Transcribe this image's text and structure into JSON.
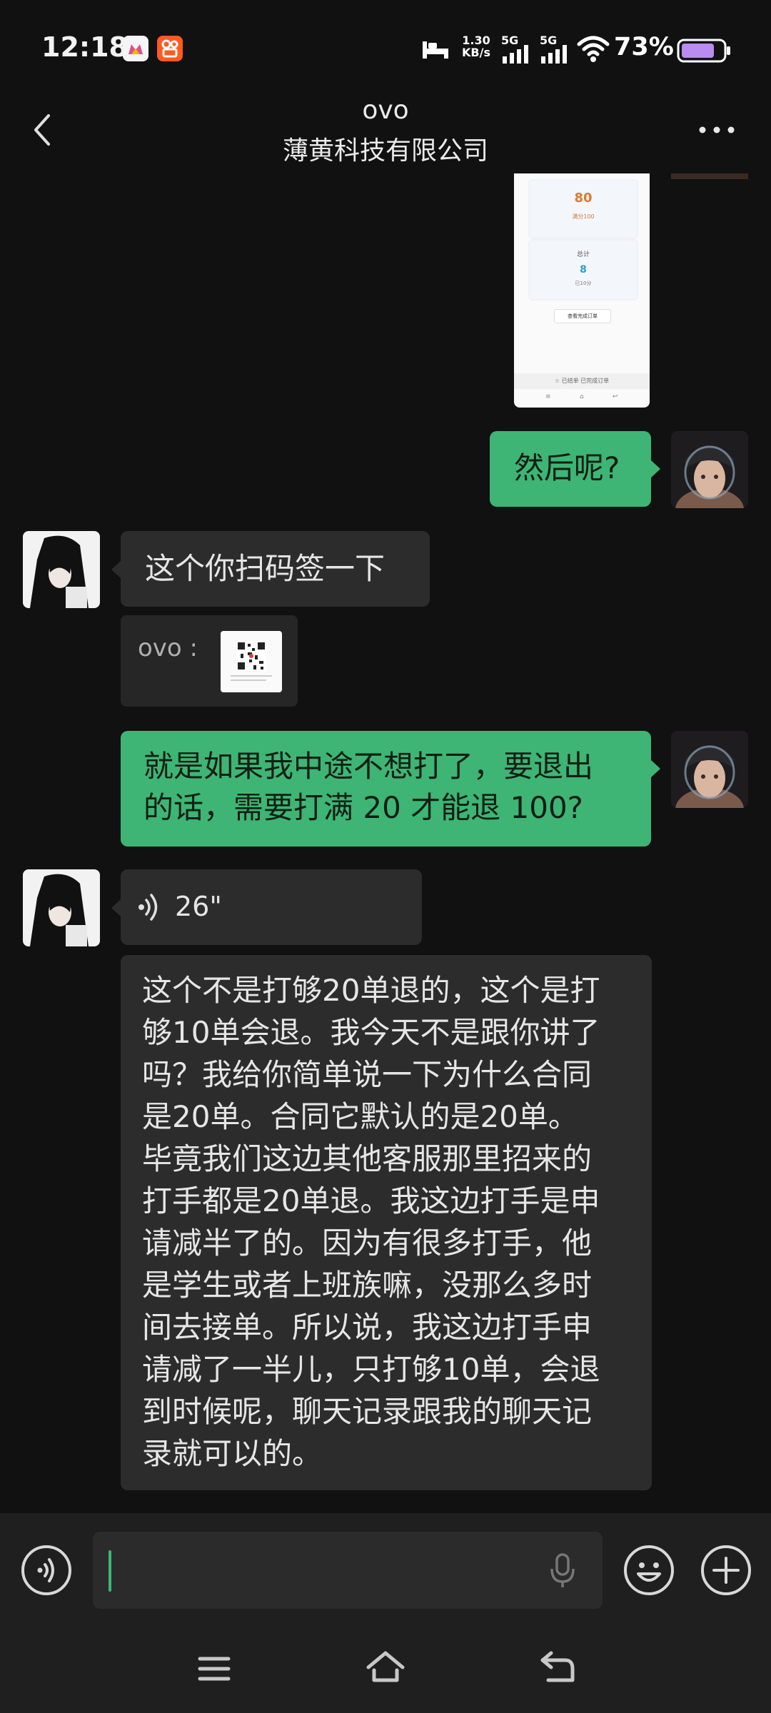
{
  "status": {
    "time": "12:18",
    "net_speed_top": "1.30",
    "net_speed_bottom": "KB/s",
    "sim1": "5G",
    "sim2": "5G",
    "battery": "73%"
  },
  "header": {
    "title": "ovo",
    "subtitle": "薄黄科技有限公司"
  },
  "screenshot_card": {
    "value1": "80",
    "value1_sub": "满分100",
    "label2": "总计",
    "value2": "8",
    "value2_sub": "已10分",
    "button": "查看完成订单",
    "footer": "☆ 已结单   已完成订单"
  },
  "messages": {
    "m1": "然后呢?",
    "m2": "这个你扫码签一下",
    "m3_sender": "ovo :",
    "m4": "就是如果我中途不想打了，要退出的话，需要打满 20 才能退 100?",
    "m4_line1": "就是如果我中途不想打了，要退出",
    "m4_line2": "的话，需要打满 20 才能退 100?",
    "voice_duration": "26\"",
    "transcript_lines": [
      "这个不是打够20单退的，这个是打",
      "够10单会退。我今天不是跟你讲了",
      "吗？我给你简单说一下为什么合同",
      "是20单。合同它默认的是20单。",
      "毕竟我们这边其他客服那里招来的",
      "打手都是20单退。我这边打手是申",
      "请减半了的。因为有很多打手，他",
      "是学生或者上班族嘛，没那么多时",
      "间去接单。所以说，我这边打手申",
      "请减了一半儿，只打够10单，会退",
      "到时候呢，聊天记录跟我的聊天记",
      "录就可以的。"
    ]
  },
  "colors": {
    "accent_green": "#3eb575",
    "bubble_gray": "#2c2c2c",
    "background": "#111111"
  }
}
